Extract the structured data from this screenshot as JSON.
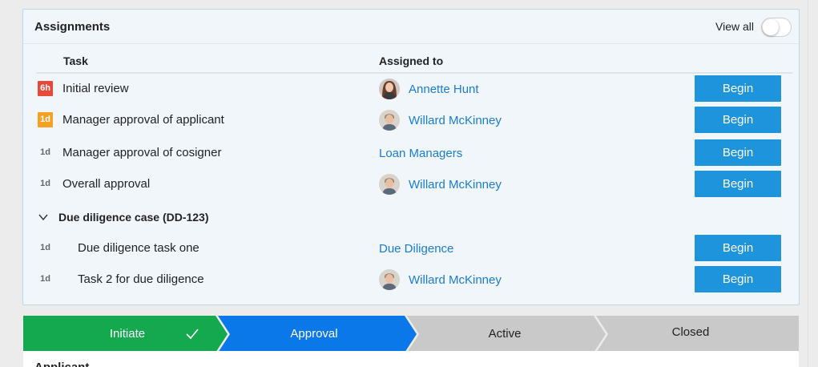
{
  "panel": {
    "title": "Assignments",
    "view_all_label": "View all",
    "view_all_on": false
  },
  "columns": {
    "task": "Task",
    "assigned_to": "Assigned to"
  },
  "rows": [
    {
      "badge": "6h",
      "badge_style": "red",
      "task": "Initial review",
      "assignee": "Annette Hunt",
      "avatar": "female-avatar",
      "action": "Begin"
    },
    {
      "badge": "1d",
      "badge_style": "orange",
      "task": "Manager approval of applicant",
      "assignee": "Willard McKinney",
      "avatar": "male-avatar",
      "action": "Begin"
    },
    {
      "badge": "1d",
      "badge_style": "plain",
      "task": "Manager approval of cosigner",
      "assignee": "Loan Managers",
      "avatar": "",
      "action": "Begin"
    },
    {
      "badge": "1d",
      "badge_style": "plain",
      "task": "Overall approval",
      "assignee": "Willard McKinney",
      "avatar": "male-avatar",
      "action": "Begin"
    }
  ],
  "group": {
    "label": "Due diligence case (DD-123)",
    "expanded": true,
    "rows": [
      {
        "badge": "1d",
        "badge_style": "plain",
        "task": "Due diligence task one",
        "assignee": "Due Diligence",
        "avatar": "",
        "action": "Begin"
      },
      {
        "badge": "1d",
        "badge_style": "plain",
        "task": "Task 2 for due diligence",
        "assignee": "Willard McKinney",
        "avatar": "male-avatar",
        "action": "Begin"
      }
    ]
  },
  "stages": [
    {
      "label": "Initiate",
      "state": "completed",
      "icon": "check-icon"
    },
    {
      "label": "Approval",
      "state": "current"
    },
    {
      "label": "Active",
      "state": "pending"
    },
    {
      "label": "Closed",
      "state": "pending"
    }
  ],
  "section_below": {
    "label": "Applicant"
  },
  "colors": {
    "link": "#1a7cd0",
    "button": "#1e94dd",
    "stage_completed": "#14a84f",
    "stage_current": "#0a78e8",
    "stage_pending": "#c9c9c9",
    "badge_red": "#e8483a",
    "badge_orange": "#f5a020"
  }
}
